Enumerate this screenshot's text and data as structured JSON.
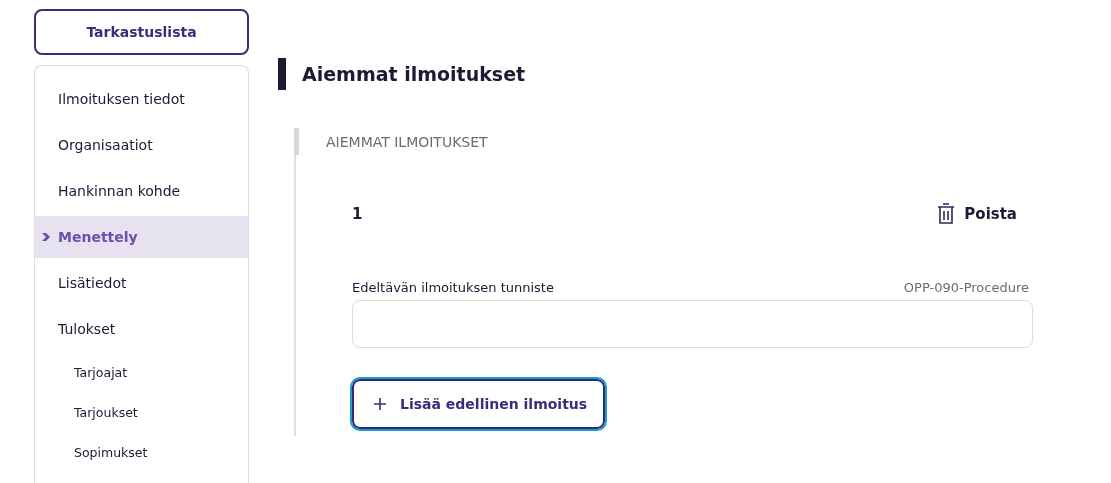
{
  "checklist_button": "Tarkastuslista",
  "nav": [
    {
      "label": "Ilmoituksen tiedot",
      "selected": false
    },
    {
      "label": "Organisaatiot",
      "selected": false
    },
    {
      "label": "Hankinnan kohde",
      "selected": false
    },
    {
      "label": "Menettely",
      "selected": true
    },
    {
      "label": "Lisätiedot",
      "selected": false
    },
    {
      "label": "Tulokset",
      "selected": false,
      "children": [
        {
          "label": "Tarjoajat",
          "selected": false
        },
        {
          "label": "Tarjoukset",
          "selected": false
        },
        {
          "label": "Sopimukset",
          "selected": false
        }
      ]
    }
  ],
  "heading": "Aiemmat ilmoitukset",
  "section": {
    "label": "AIEMMAT ILMOITUKSET",
    "items": [
      {
        "number": "1",
        "remove_button": "Poista",
        "field": {
          "label": "Edeltävän ilmoituksen tunniste",
          "code": "OPP-090-Procedure"
        }
      }
    ],
    "add_button": "Lisää edellinen ilmoitus"
  }
}
